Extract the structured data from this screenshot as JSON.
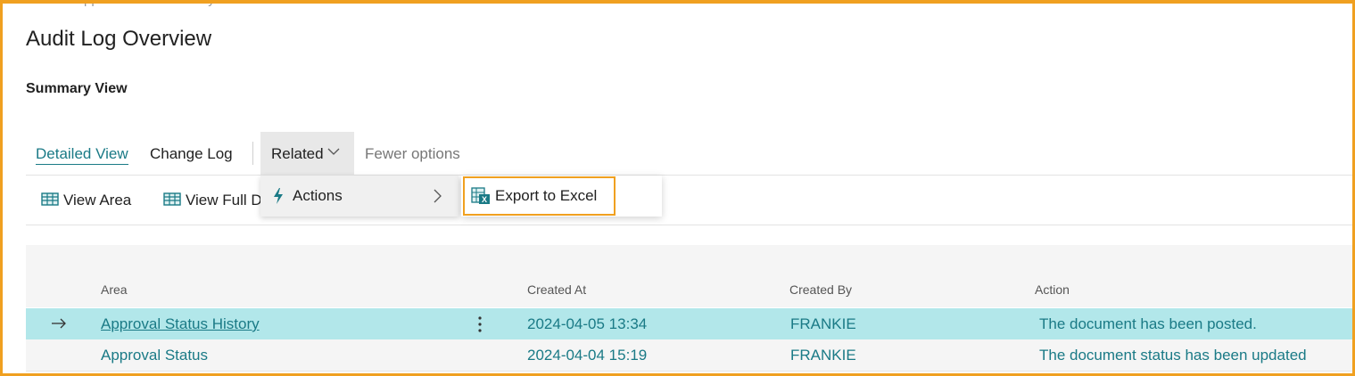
{
  "page": {
    "peek_text": "Approval Status History",
    "title": "Audit Log Overview",
    "subtitle": "Summary View"
  },
  "action_bar": {
    "tabs": [
      {
        "label": "Detailed View"
      },
      {
        "label": "Change Log"
      },
      {
        "label": "Related"
      },
      {
        "label": "Fewer options"
      }
    ]
  },
  "sub_actions": [
    {
      "label": "View Area",
      "icon": "view-area-icon"
    },
    {
      "label": "View Full D",
      "icon": "view-full-icon"
    }
  ],
  "related_menu": {
    "items": [
      {
        "label": "Actions",
        "icon": "lightning-icon"
      }
    ],
    "submenu": [
      {
        "label": "Export to Excel",
        "icon": "excel-icon"
      }
    ]
  },
  "table": {
    "columns": [
      "Area",
      "Created At",
      "Created By",
      "Action"
    ],
    "rows": [
      {
        "area": "Approval Status History",
        "created_at": "2024-04-05 13:34",
        "created_by": "FRANKIE",
        "action": "The document has been posted."
      },
      {
        "area": "Approval Status",
        "created_at": "2024-04-04 15:19",
        "created_by": "FRANKIE",
        "action": "The document status has been updated"
      }
    ]
  },
  "colors": {
    "accent": "#1a7a86",
    "highlight_border": "#f0a020",
    "selected_row": "#b2e7ea"
  }
}
